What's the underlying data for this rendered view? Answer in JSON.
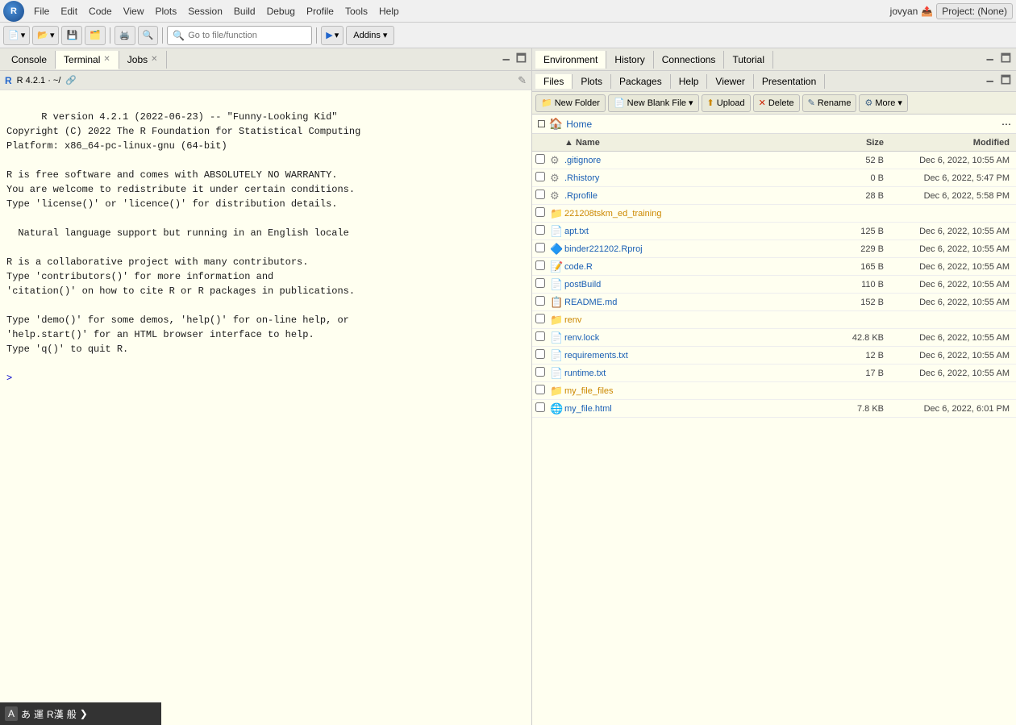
{
  "app": {
    "title": "RStudio",
    "user": "jovyan",
    "project": "Project: (None)"
  },
  "menubar": {
    "items": [
      "File",
      "Edit",
      "Code",
      "View",
      "Plots",
      "Session",
      "Build",
      "Debug",
      "Profile",
      "Tools",
      "Help"
    ]
  },
  "toolbar": {
    "goto_placeholder": "Go to file/function",
    "addins_label": "Addins"
  },
  "left_panel": {
    "tabs": [
      "Console",
      "Terminal",
      "Jobs"
    ],
    "active_tab": "Terminal",
    "console_version": "R 4.2.1 · ~/",
    "console_content": "R version 4.2.1 (2022-06-23) -- \"Funny-Looking Kid\"\nCopyright (C) 2022 The R Foundation for Statistical Computing\nPlatform: x86_64-pc-linux-gnu (64-bit)\n\nR is free software and comes with ABSOLUTELY NO WARRANTY.\nYou are welcome to redistribute it under certain conditions.\nType 'license()' or 'licence()' for distribution details.\n\n  Natural language support but running in an English locale\n\nR is a collaborative project with many contributors.\nType 'contributors()' for more information and\n'citation()' on how to cite R or R packages in publications.\n\nType 'demo()' for some demos, 'help()' for on-line help, or\n'help.start()' for an HTML browser interface to help.\nType 'q()' to quit R.\n\n> ",
    "prompt": ">"
  },
  "right_panel": {
    "top_tabs": [
      "Environment",
      "History",
      "Connections",
      "Tutorial"
    ],
    "active_top_tab": "Environment",
    "sub_tabs": [
      "Files",
      "Plots",
      "Packages",
      "Help",
      "Viewer",
      "Presentation"
    ],
    "active_sub_tab": "Files",
    "toolbar": {
      "new_folder": "New Folder",
      "new_blank_file": "New Blank File",
      "upload": "Upload",
      "delete": "Delete",
      "rename": "Rename",
      "more": "More"
    },
    "path": "Home",
    "table_headers": {
      "name": "Name",
      "size": "Size",
      "modified": "Modified"
    },
    "files": [
      {
        "name": ".gitignore",
        "size": "52 B",
        "modified": "Dec 6, 2022, 10:55 AM",
        "type": "file",
        "icon": "gear"
      },
      {
        "name": ".Rhistory",
        "size": "0 B",
        "modified": "Dec 6, 2022, 5:47 PM",
        "type": "file",
        "icon": "gear"
      },
      {
        "name": ".Rprofile",
        "size": "28 B",
        "modified": "Dec 6, 2022, 5:58 PM",
        "type": "file",
        "icon": "gear"
      },
      {
        "name": "221208tskm_ed_training",
        "size": "",
        "modified": "",
        "type": "folder",
        "icon": "folder"
      },
      {
        "name": "apt.txt",
        "size": "125 B",
        "modified": "Dec 6, 2022, 10:55 AM",
        "type": "file",
        "icon": "doc"
      },
      {
        "name": "binder221202.Rproj",
        "size": "229 B",
        "modified": "Dec 6, 2022, 10:55 AM",
        "type": "file",
        "icon": "rproj"
      },
      {
        "name": "code.R",
        "size": "165 B",
        "modified": "Dec 6, 2022, 10:55 AM",
        "type": "file",
        "icon": "rscript"
      },
      {
        "name": "postBuild",
        "size": "110 B",
        "modified": "Dec 6, 2022, 10:55 AM",
        "type": "file",
        "icon": "doc"
      },
      {
        "name": "README.md",
        "size": "152 B",
        "modified": "Dec 6, 2022, 10:55 AM",
        "type": "file",
        "icon": "md"
      },
      {
        "name": "renv",
        "size": "",
        "modified": "",
        "type": "folder",
        "icon": "folder"
      },
      {
        "name": "renv.lock",
        "size": "42.8 KB",
        "modified": "Dec 6, 2022, 10:55 AM",
        "type": "file",
        "icon": "doc"
      },
      {
        "name": "requirements.txt",
        "size": "12 B",
        "modified": "Dec 6, 2022, 10:55 AM",
        "type": "file",
        "icon": "doc"
      },
      {
        "name": "runtime.txt",
        "size": "17 B",
        "modified": "Dec 6, 2022, 10:55 AM",
        "type": "file",
        "icon": "doc"
      },
      {
        "name": "my_file_files",
        "size": "",
        "modified": "",
        "type": "folder",
        "icon": "folder"
      },
      {
        "name": "my_file.html",
        "size": "7.8 KB",
        "modified": "Dec 6, 2022, 6:01 PM",
        "type": "file",
        "icon": "globe"
      }
    ]
  },
  "bottom_bar": {
    "items": [
      "A",
      "あ",
      "運",
      "R漢",
      "般"
    ]
  }
}
